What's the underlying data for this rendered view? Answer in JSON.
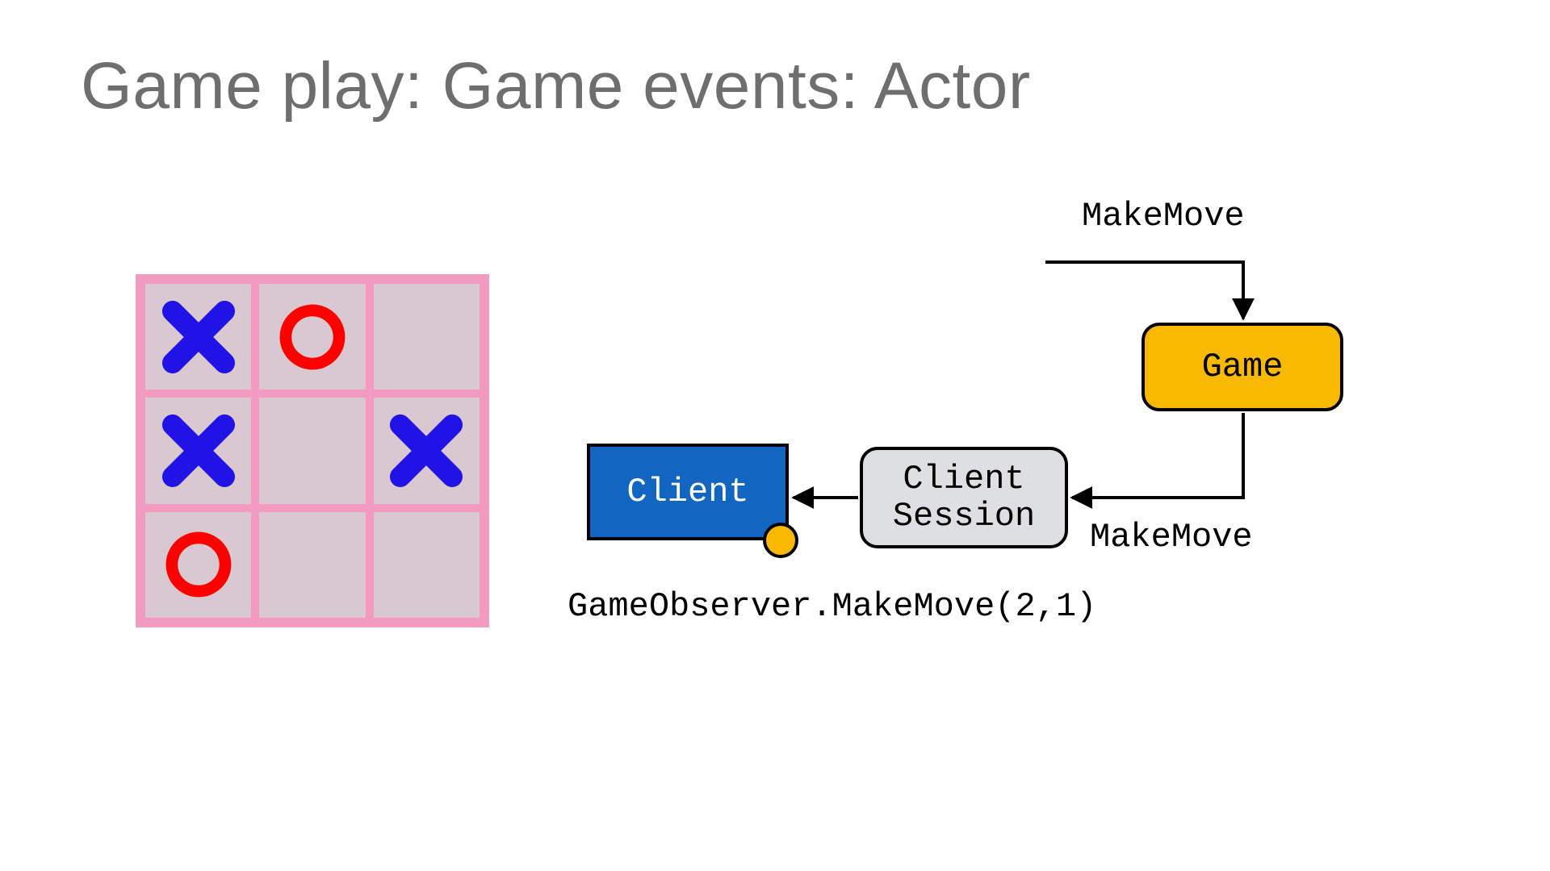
{
  "title": "Game play: Game events: Actor",
  "board": {
    "cells": [
      "X",
      "O",
      "",
      "X",
      "",
      "X",
      "O",
      "",
      ""
    ]
  },
  "diagram": {
    "labels": {
      "makemove_top": "MakeMove",
      "makemove_bottom": "MakeMove",
      "observer_call": "GameObserver.MakeMove(2,1)"
    },
    "nodes": {
      "game": "Game",
      "client": "Client",
      "session_line1": "Client",
      "session_line2": "Session"
    }
  },
  "colors": {
    "board_bg": "#f39ac1",
    "cell_bg": "#d9c8cf",
    "x_color": "#2113e5",
    "o_color": "#ff0000",
    "game_fill": "#f9b900",
    "client_fill": "#1266c2",
    "session_fill": "#dddfe1"
  }
}
